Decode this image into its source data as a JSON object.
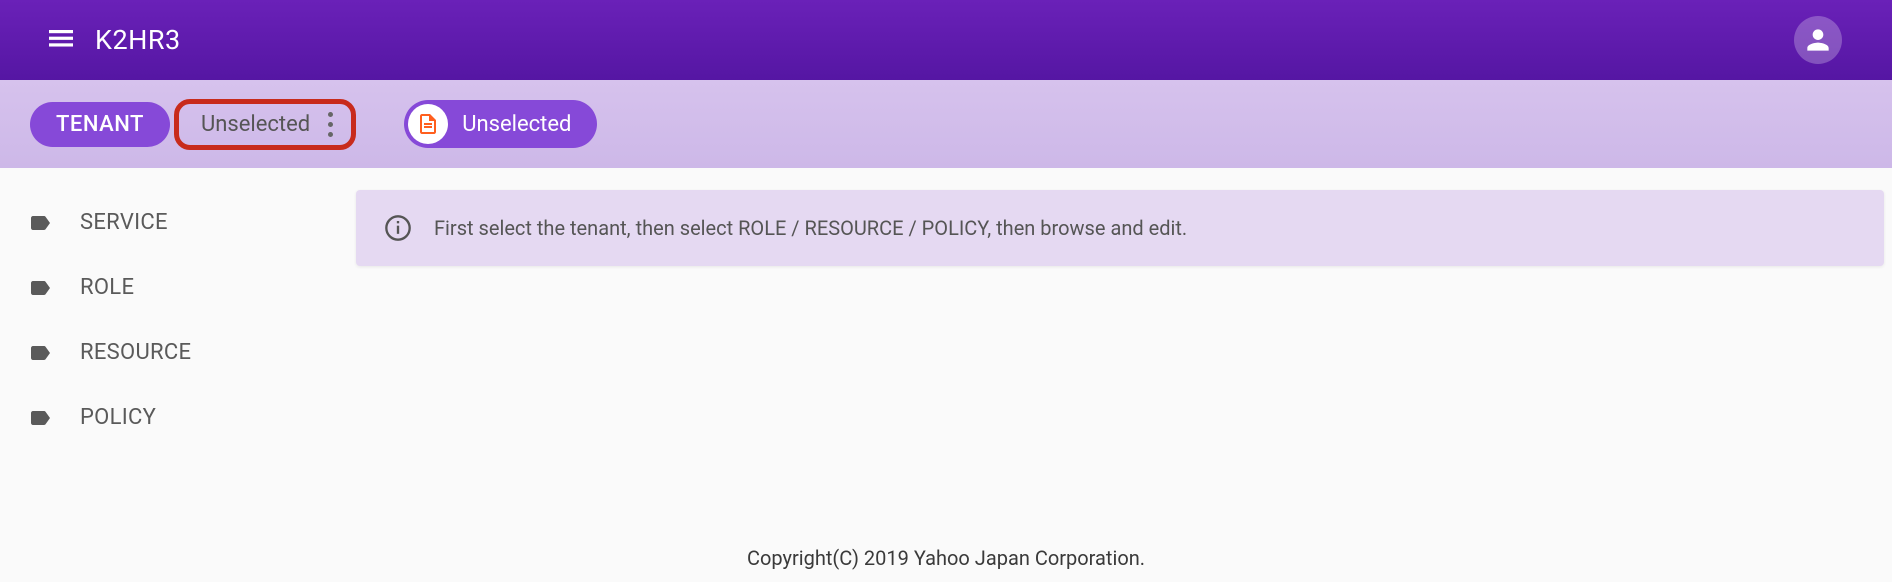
{
  "header": {
    "title": "K2HR3"
  },
  "subheader": {
    "tenant_label": "TENANT",
    "tenant_value": "Unselected",
    "resource_value": "Unselected"
  },
  "sidebar": {
    "items": [
      {
        "label": "SERVICE"
      },
      {
        "label": "ROLE"
      },
      {
        "label": "RESOURCE"
      },
      {
        "label": "POLICY"
      }
    ]
  },
  "main": {
    "info_message": "First select the tenant, then select ROLE / RESOURCE / POLICY, then browse and edit."
  },
  "footer": {
    "copyright": "Copyright(C) 2019 Yahoo Japan Corporation."
  }
}
